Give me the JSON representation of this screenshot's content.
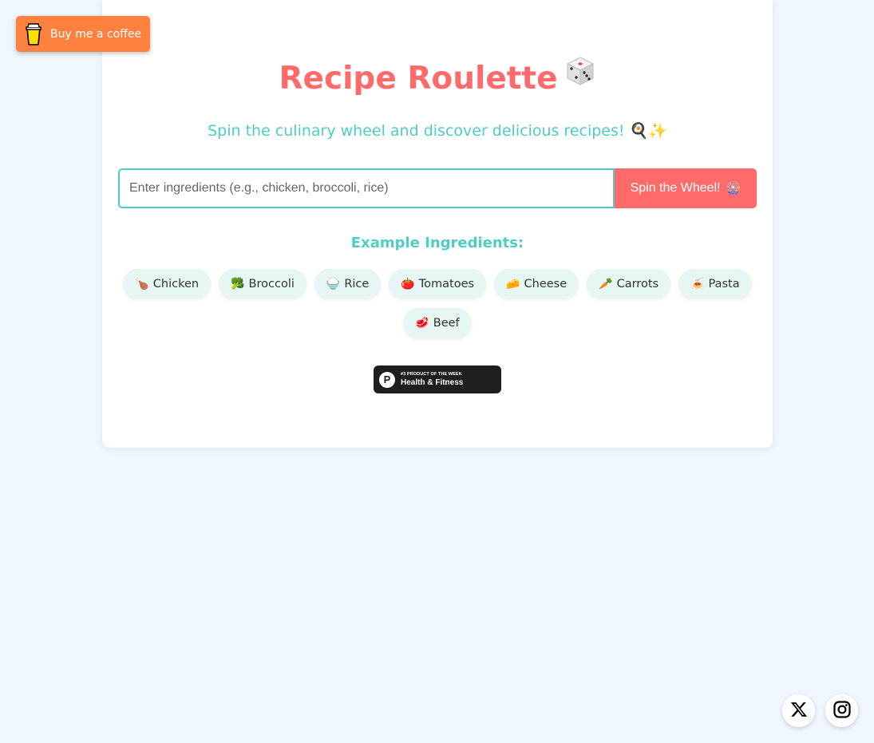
{
  "coffee_button": {
    "label": "Buy me a coffee",
    "color": "#ff813f"
  },
  "header": {
    "title": "Recipe Roulette",
    "title_emoji": "🎲",
    "subtitle": "Spin the culinary wheel and discover delicious recipes! 🍳✨"
  },
  "search": {
    "placeholder": "Enter ingredients (e.g., chicken, broccoli, rice)",
    "value": "",
    "button_label": "Spin the Wheel!",
    "button_emoji": "🎡"
  },
  "examples": {
    "title": "Example Ingredients:",
    "items": [
      {
        "emoji": "🍗",
        "label": "Chicken"
      },
      {
        "emoji": "🥦",
        "label": "Broccoli"
      },
      {
        "emoji": "🍚",
        "label": "Rice"
      },
      {
        "emoji": "🍅",
        "label": "Tomatoes"
      },
      {
        "emoji": "🧀",
        "label": "Cheese"
      },
      {
        "emoji": "🥕",
        "label": "Carrots"
      },
      {
        "emoji": "🍝",
        "label": "Pasta"
      },
      {
        "emoji": "🥩",
        "label": "Beef"
      }
    ]
  },
  "badge": {
    "small_text": "#3 PRODUCT OF THE WEEK",
    "main_text": "Health & Fitness",
    "logo_letter": "P"
  },
  "social": [
    {
      "icon": "x-icon"
    },
    {
      "icon": "instagram-icon"
    }
  ],
  "colors": {
    "accent": "#ff6b6b",
    "teal": "#4ecdc4",
    "background": "#eff6fd"
  }
}
